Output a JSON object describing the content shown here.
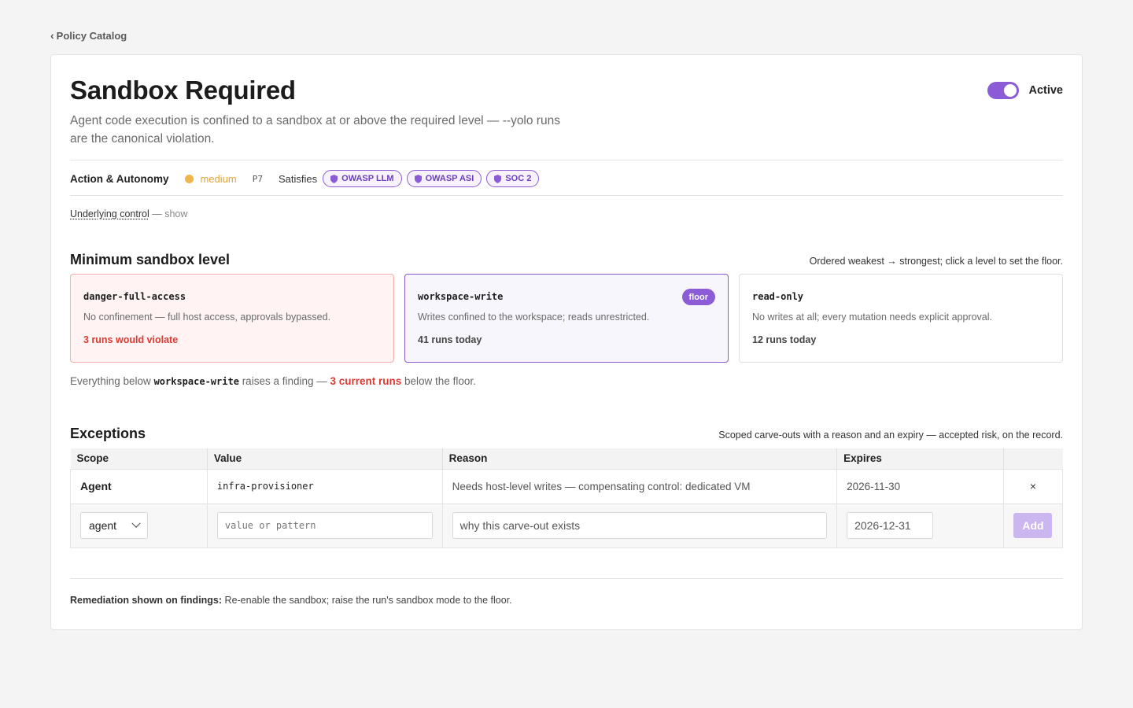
{
  "breadcrumb": {
    "back_label": "Policy Catalog"
  },
  "policy": {
    "title": "Sandbox Required",
    "description": "Agent code execution is confined to a sandbox at or above the required level — --yolo runs are the canonical violation.",
    "status_label": "Active",
    "active": true
  },
  "meta": {
    "category": "Action & Autonomy",
    "severity": "medium",
    "severity_color": "#f0b64a",
    "priority": "P7",
    "satisfies_label": "Satisfies",
    "frameworks": [
      "OWASP LLM",
      "OWASP ASI",
      "SOC 2"
    ],
    "framework_icon": "shield-icon"
  },
  "control": {
    "link_label": "Underlying control",
    "separator": " — ",
    "toggle_label": "show"
  },
  "sandbox": {
    "heading": "Minimum sandbox level",
    "note": "Ordered weakest → strongest; click a level to set the floor.",
    "floor_badge": "floor",
    "levels": [
      {
        "name": "danger-full-access",
        "description": "No confinement — full host access, approvals bypassed.",
        "runs": "3 runs would violate"
      },
      {
        "name": "workspace-write",
        "description": "Writes confined to the workspace; reads unrestricted.",
        "runs": "41 runs today"
      },
      {
        "name": "read-only",
        "description": "No writes at all; every mutation needs explicit approval.",
        "runs": "12 runs today"
      }
    ],
    "below_prefix": "Everything below ",
    "below_level": "workspace-write",
    "below_mid": " raises a finding — ",
    "below_count": "3 current runs",
    "below_suffix": " below the floor."
  },
  "exceptions": {
    "heading": "Exceptions",
    "note": "Scoped carve-outs with a reason and an expiry — accepted risk, on the record.",
    "columns": [
      "Scope",
      "Value",
      "Reason",
      "Expires",
      ""
    ],
    "rows": [
      {
        "scope": "Agent",
        "value": "infra-provisioner",
        "reason": "Needs host-level writes — compensating control: dedicated VM",
        "expires": "2026-11-30",
        "remove": "×"
      }
    ],
    "new": {
      "scope_value": "agent",
      "value_placeholder": "value or pattern",
      "reason_placeholder": "why this carve-out exists",
      "expires_value": "2026-12-31",
      "add_label": "Add"
    }
  },
  "remediation": {
    "label": "Remediation shown on findings:",
    "text": " Re-enable the sandbox; raise the run's sandbox mode to the floor."
  }
}
